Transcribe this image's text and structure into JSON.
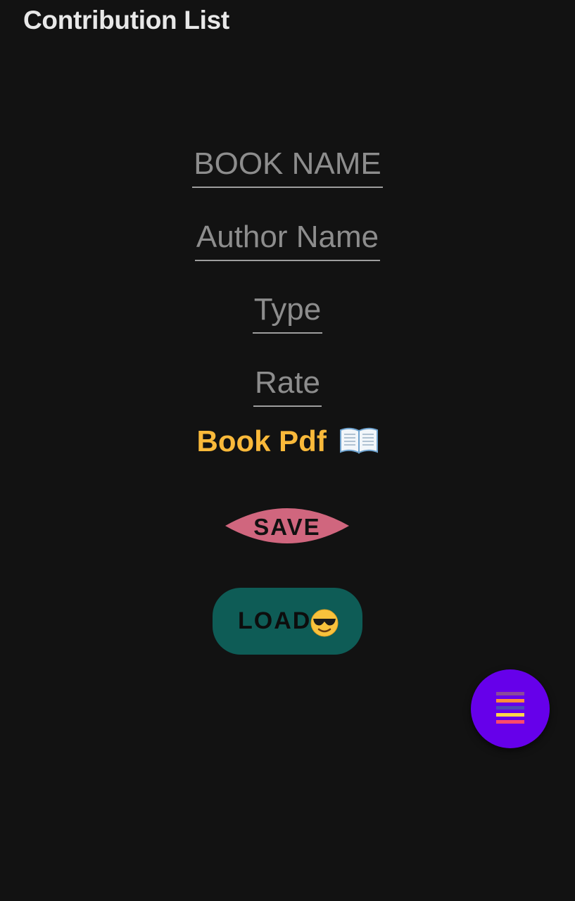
{
  "app": {
    "title": "Contribution List"
  },
  "form": {
    "book_name_placeholder": "BOOK NAME",
    "author_name_placeholder": "Author Name",
    "type_placeholder": "Type",
    "rate_placeholder": "Rate"
  },
  "book_pdf": {
    "label": "Book Pdf",
    "icon": "open-book-icon"
  },
  "buttons": {
    "save_label": "SAVE",
    "load_label": "LOAD",
    "load_icon": "sunglasses-face-icon"
  },
  "fab": {
    "icon": "menu-lines-icon"
  },
  "colors": {
    "background": "#121212",
    "title": "#e8e8e8",
    "placeholder": "#8d8d8d",
    "book_pdf": "#f9b93a",
    "save_button": "#d0667e",
    "load_button": "#0e5c56",
    "fab": "#6600ea"
  }
}
